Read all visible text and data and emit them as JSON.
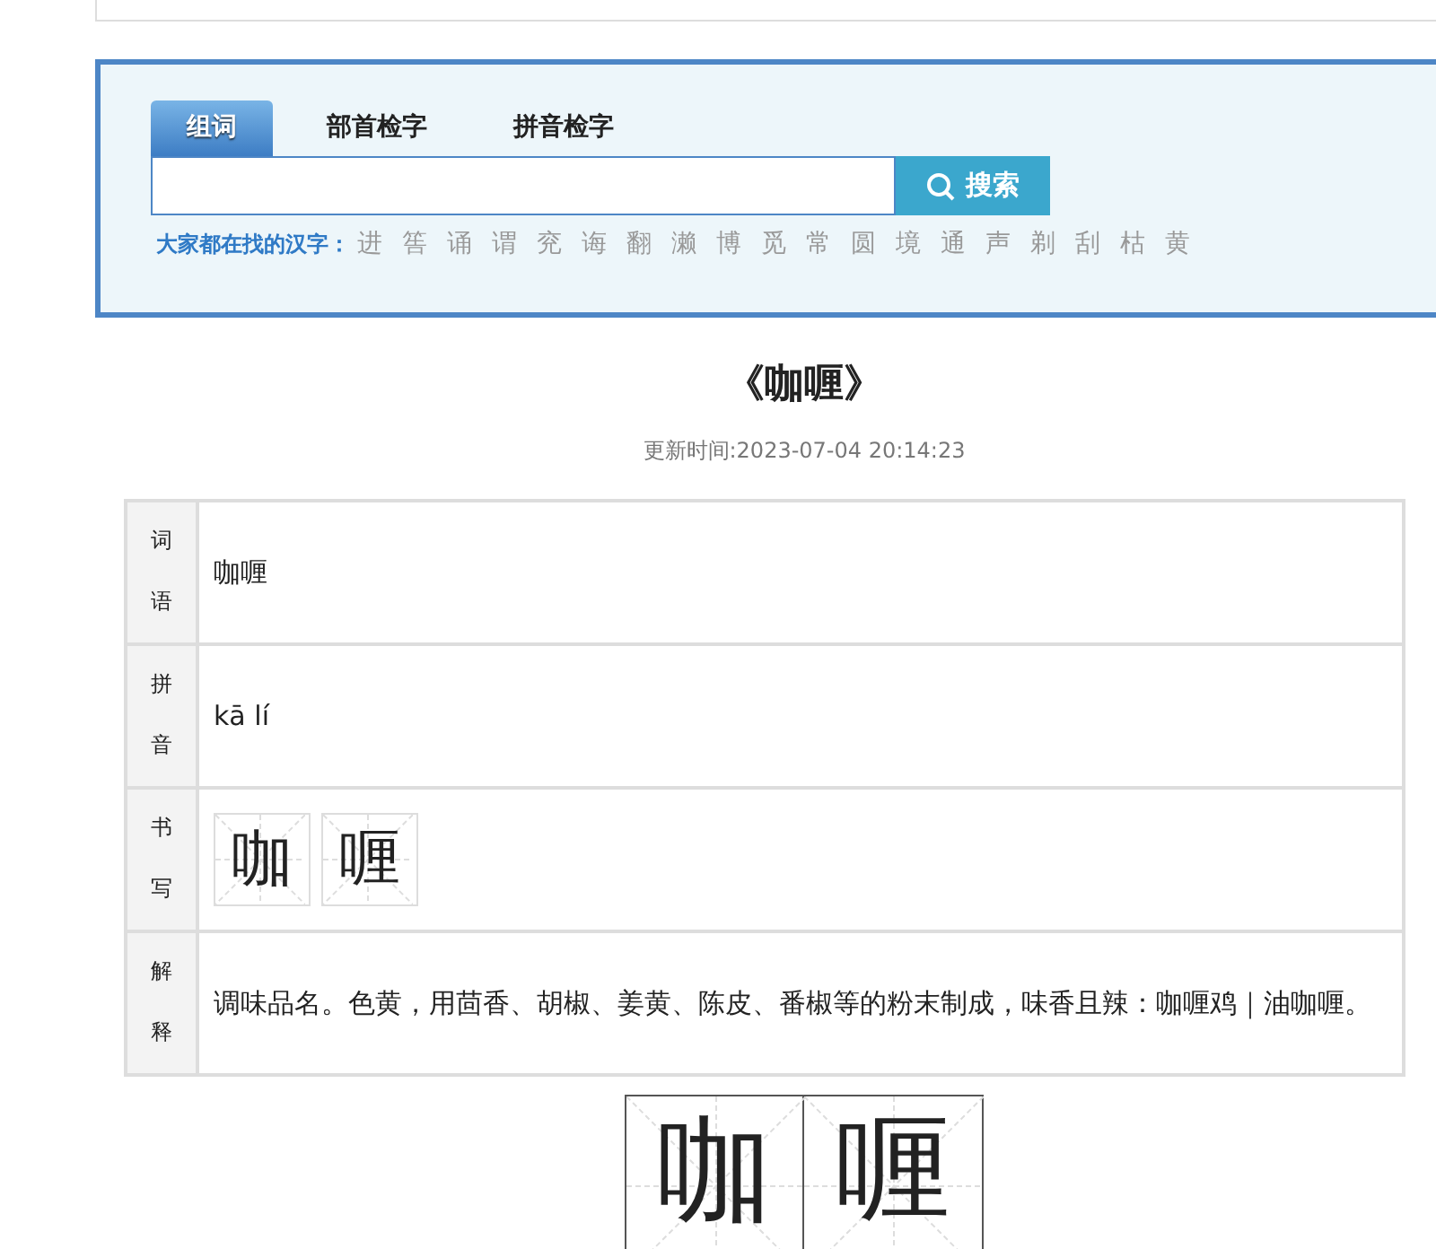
{
  "tabs": [
    {
      "label": "组词",
      "selected": true
    },
    {
      "label": "部首检字",
      "selected": false
    },
    {
      "label": "拼音检字",
      "selected": false
    }
  ],
  "search": {
    "button": "搜索"
  },
  "hot": {
    "label": "大家都在找的汉字：",
    "chars": [
      "进",
      "筶",
      "诵",
      "谓",
      "兖",
      "诲",
      "翻",
      "濑",
      "博",
      "觅",
      "常",
      "圆",
      "境",
      "通",
      "声",
      "剃",
      "刮",
      "枯",
      "黄"
    ]
  },
  "title": "《咖喱》",
  "updated": "更新时间:2023-07-04 20:14:23",
  "rows": [
    {
      "kind": "text",
      "label": "词语",
      "value": "咖喱"
    },
    {
      "kind": "text",
      "label": "拼音",
      "value": "kā lí"
    },
    {
      "kind": "tiles",
      "label": "书写",
      "chars": [
        "咖",
        "喱"
      ]
    },
    {
      "kind": "text",
      "label": "解释",
      "value": "调味品名。色黄，用茴香、胡椒、姜黄、陈皮、番椒等的粉末制成，味香且辣：咖喱鸡｜油咖喱。"
    }
  ],
  "stroke_chars": [
    "咖",
    "喱"
  ]
}
